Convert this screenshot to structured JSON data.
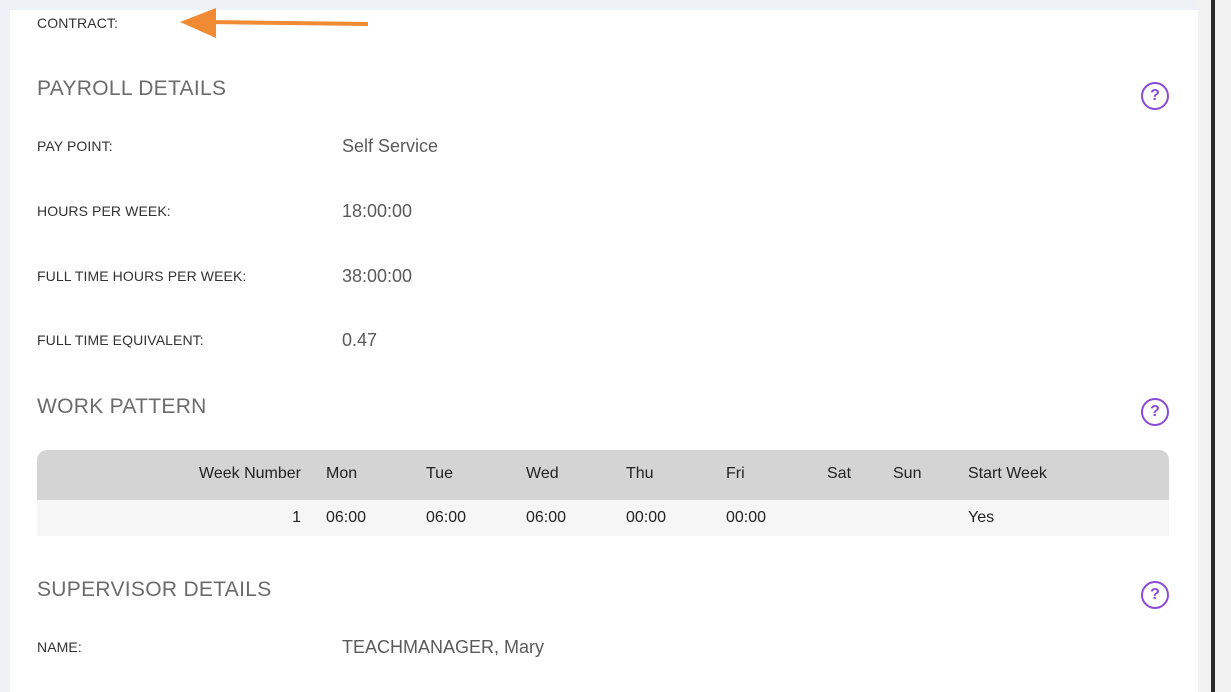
{
  "contract": {
    "label": "CONTRACT:"
  },
  "payroll": {
    "title": "PAYROLL DETAILS",
    "help": "?",
    "fields": [
      {
        "label": "PAY POINT:",
        "value": "Self Service"
      },
      {
        "label": "HOURS PER WEEK:",
        "value": "18:00:00"
      },
      {
        "label": "FULL TIME HOURS PER WEEK:",
        "value": "38:00:00"
      },
      {
        "label": "FULL TIME EQUIVALENT:",
        "value": "0.47"
      }
    ]
  },
  "work_pattern": {
    "title": "WORK PATTERN",
    "help": "?",
    "headers": [
      "Week Number",
      "Mon",
      "Tue",
      "Wed",
      "Thu",
      "Fri",
      "Sat",
      "Sun",
      "Start Week"
    ],
    "rows": [
      [
        "1",
        "06:00",
        "06:00",
        "06:00",
        "00:00",
        "00:00",
        "",
        "",
        "Yes"
      ]
    ]
  },
  "supervisor": {
    "title": "SUPERVISOR DETAILS",
    "help": "?",
    "name_label": "NAME:",
    "name_value": "TEACHMANAGER, Mary"
  },
  "colors": {
    "accent": "#8a4bd6",
    "arrow": "#f08a33",
    "table_header": "#d4d4d4"
  },
  "icons": [
    "help-icon",
    "arrow-annotation"
  ]
}
